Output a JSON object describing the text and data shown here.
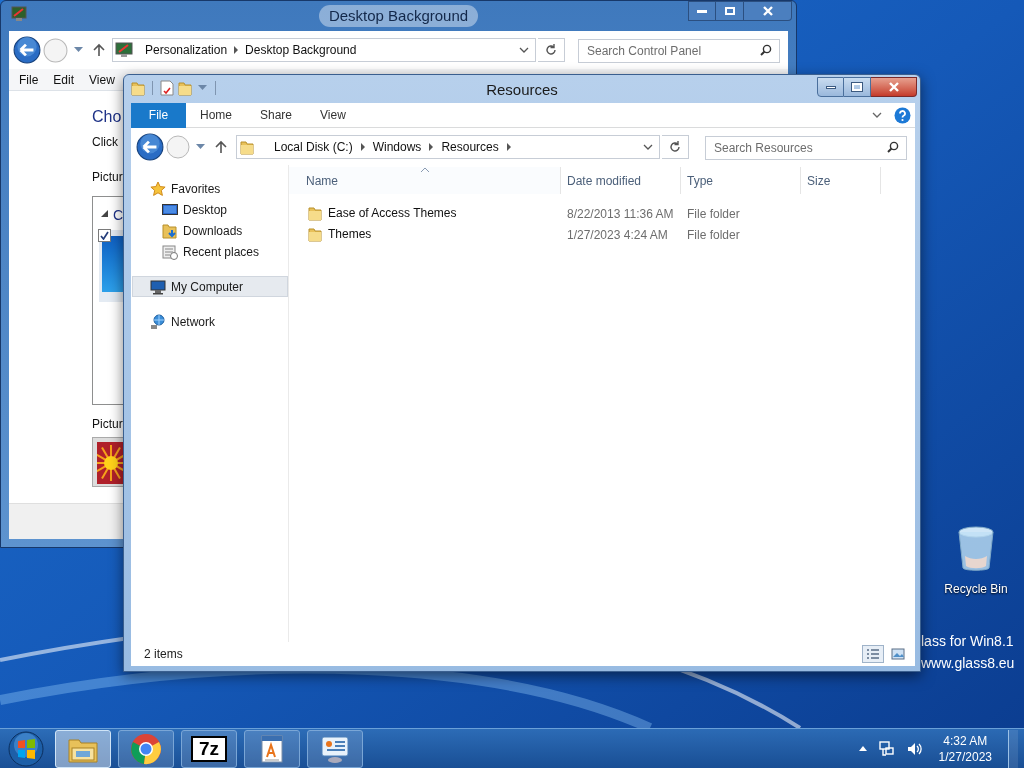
{
  "desktop": {
    "icons": [
      {
        "label": "Recycle Bin"
      }
    ],
    "branding": [
      "lass for Win8.1",
      "www.glass8.eu"
    ]
  },
  "back_window": {
    "title": "Desktop Background",
    "breadcrumb": [
      "Personalization",
      "Desktop Background"
    ],
    "search": {
      "placeholder": "Search Control Panel"
    },
    "menu": [
      "File",
      "Edit",
      "View"
    ],
    "heading": "Cho",
    "instruction": "Click",
    "label_1": "Pictur",
    "group": {
      "label": "C",
      "expanded": true,
      "item_checked": true
    },
    "label_2": "Pictur"
  },
  "front_window": {
    "title": "Resources",
    "ribbon_tabs": [
      {
        "label": "File",
        "kind": "file"
      },
      {
        "label": "Home",
        "kind": "tab"
      },
      {
        "label": "Share",
        "kind": "tab"
      },
      {
        "label": "View",
        "kind": "tab"
      }
    ],
    "breadcrumb": [
      "Local Disk (C:)",
      "Windows",
      "Resources"
    ],
    "search": {
      "placeholder": "Search Resources"
    },
    "navigation": [
      {
        "label": "Favorites",
        "selected": false,
        "children": [
          {
            "label": "Desktop",
            "selected": false
          },
          {
            "label": "Downloads",
            "selected": false
          },
          {
            "label": "Recent places",
            "selected": false
          }
        ]
      },
      {
        "label": "My Computer",
        "selected": true
      },
      {
        "label": "Network",
        "selected": false
      }
    ],
    "columns": [
      {
        "label": "Name",
        "sorted": true
      },
      {
        "label": "Date modified",
        "sorted": false
      },
      {
        "label": "Type",
        "sorted": false
      },
      {
        "label": "Size",
        "sorted": false
      }
    ],
    "rows": [
      {
        "name": "Ease of Access Themes",
        "date_modified": "8/22/2013 11:36 AM",
        "type": "File folder"
      },
      {
        "name": "Themes",
        "date_modified": "1/27/2023 4:24 AM",
        "type": "File folder"
      }
    ],
    "status": "2 items",
    "view_buttons": [
      {
        "selected": true
      },
      {
        "selected": false
      }
    ]
  },
  "taskbar": {
    "buttons": [
      {
        "active": true
      },
      {
        "active": false
      },
      {
        "active": false,
        "logo_text": "7z"
      },
      {
        "active": false
      },
      {
        "active": false
      }
    ],
    "clock": {
      "time": "4:32 AM",
      "date": "1/27/2023"
    }
  }
}
